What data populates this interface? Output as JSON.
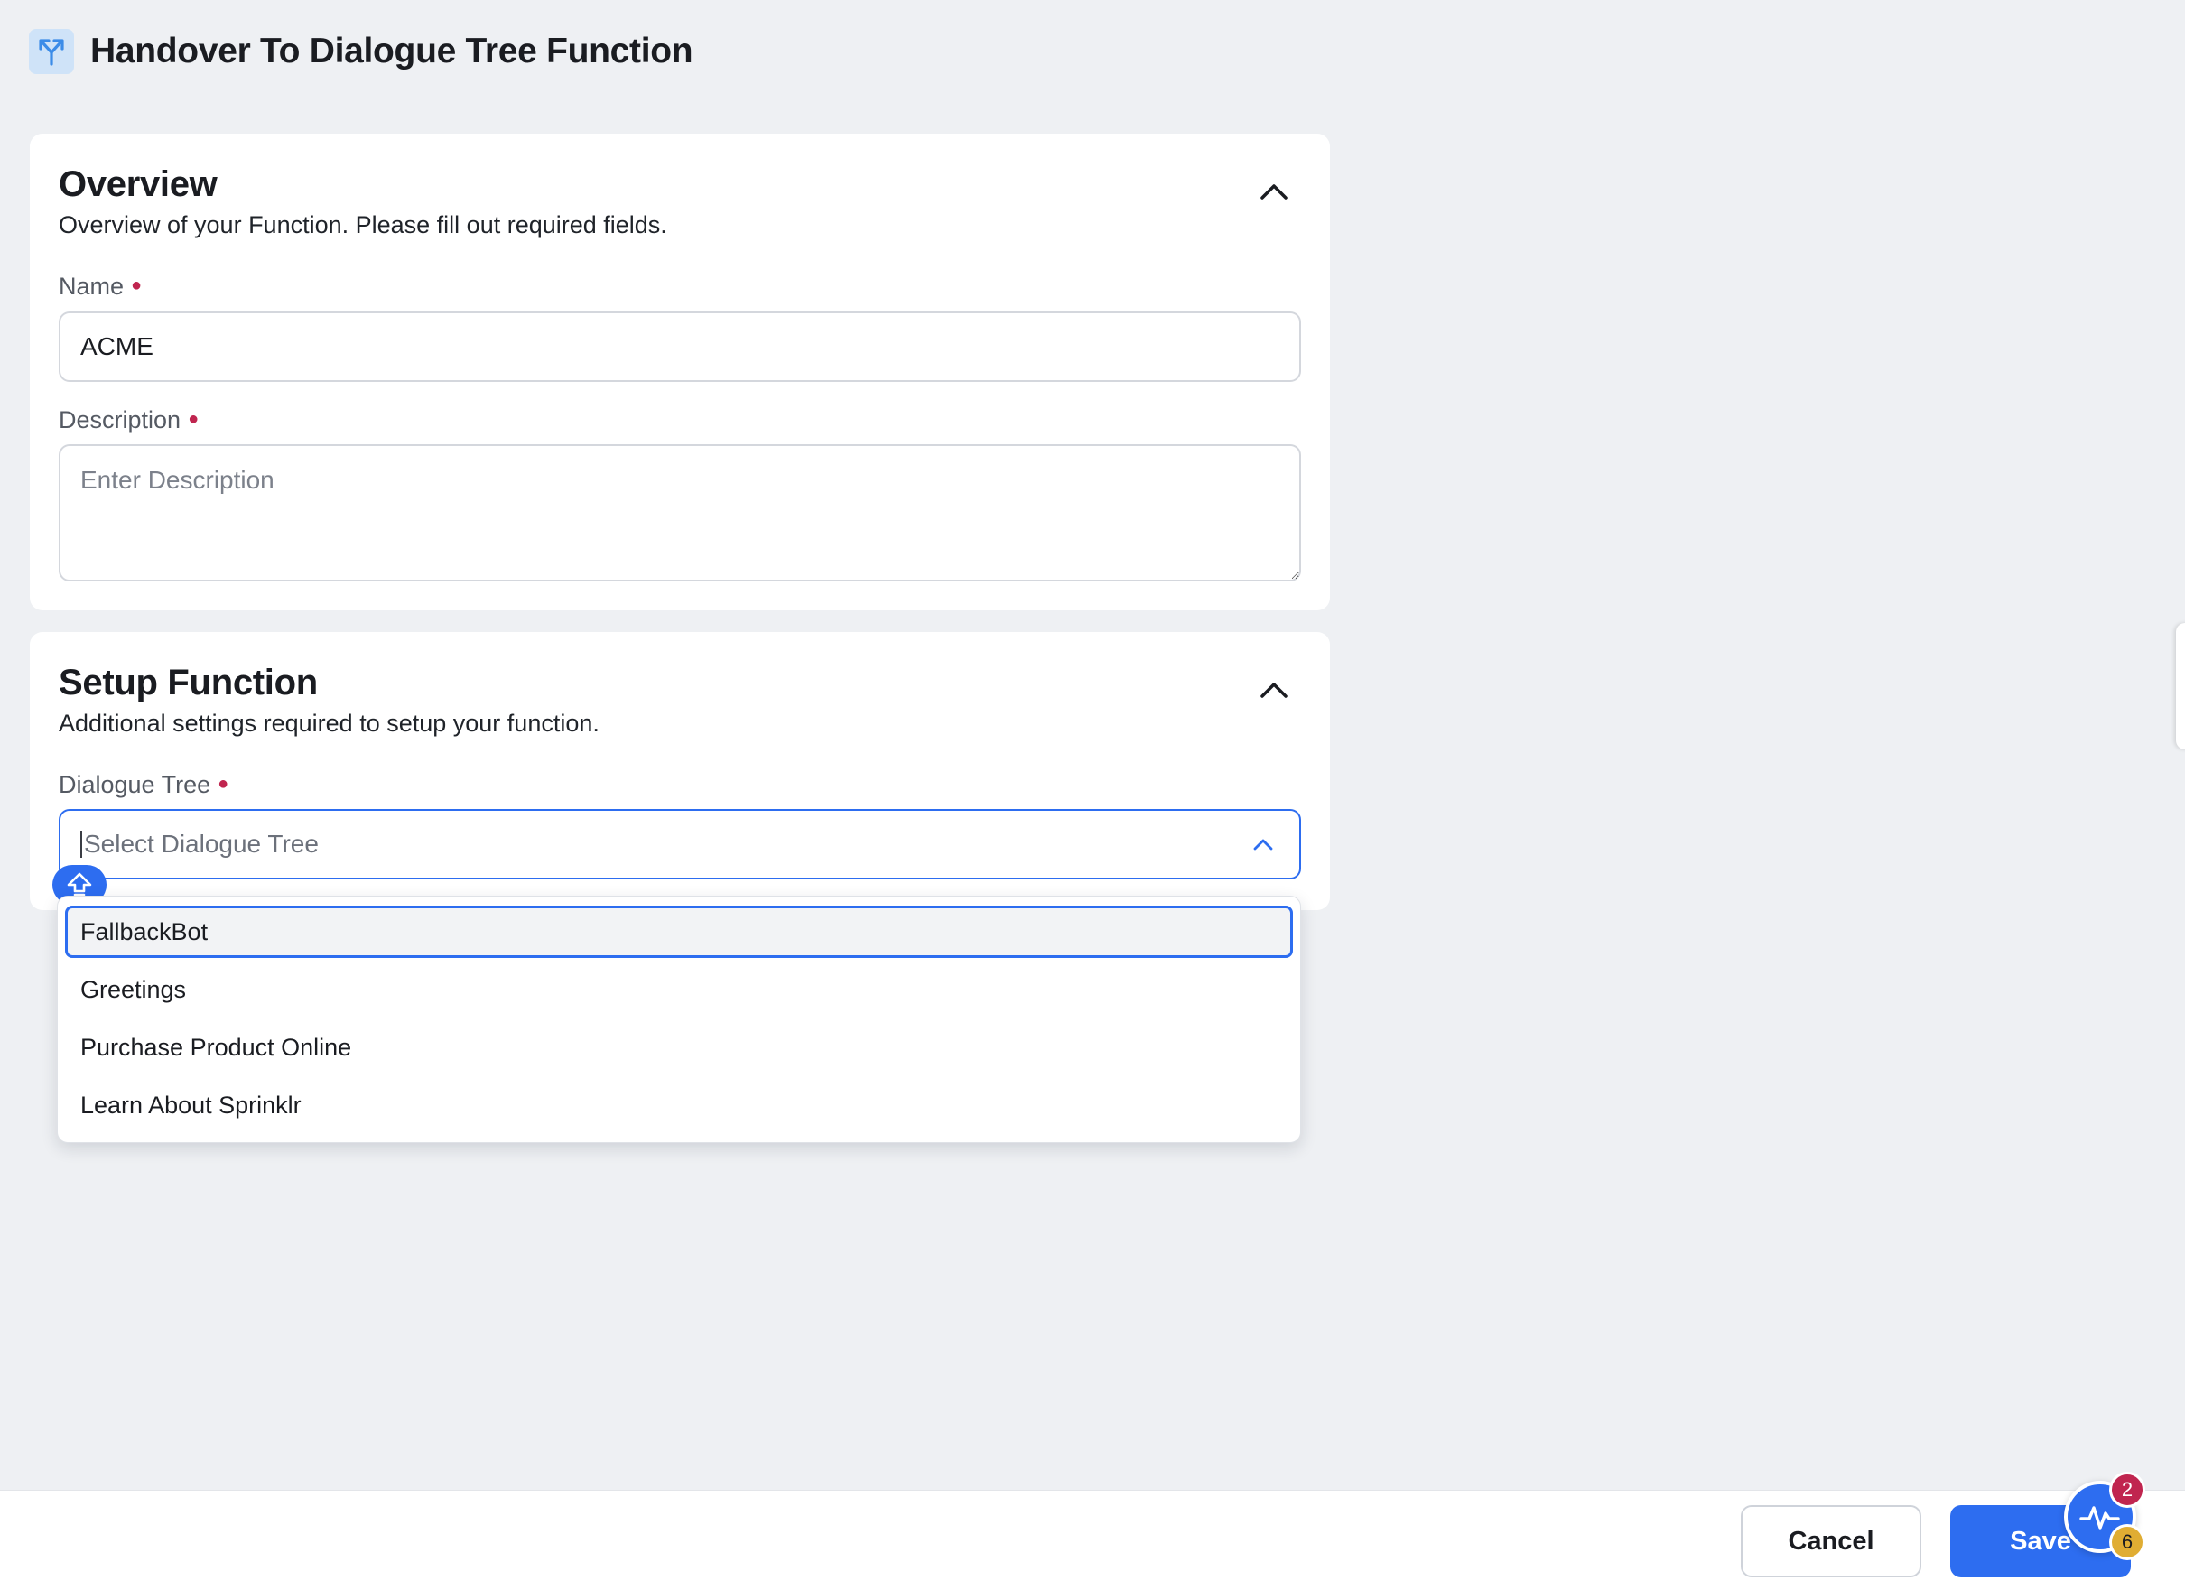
{
  "header": {
    "title": "Handover To Dialogue Tree Function",
    "icon": "split-arrow-icon"
  },
  "overview": {
    "title": "Overview",
    "subtitle": "Overview of your Function. Please fill out required fields.",
    "name_label": "Name",
    "name_value": "ACME",
    "description_label": "Description",
    "description_placeholder": "Enter Description"
  },
  "setup": {
    "title": "Setup Function",
    "subtitle": "Additional settings required to setup your function.",
    "dialogue_tree_label": "Dialogue Tree",
    "dialogue_tree_placeholder": "Select Dialogue Tree",
    "options": [
      "FallbackBot",
      "Greetings",
      "Purchase Product Online",
      "Learn About Sprinklr"
    ],
    "highlighted_option": "FallbackBot"
  },
  "footer": {
    "cancel_label": "Cancel",
    "save_label": "Save"
  },
  "widget": {
    "badge_red": "2",
    "badge_yellow": "6",
    "icon": "activity-pulse-icon"
  },
  "colors": {
    "accent": "#2d6df0",
    "required": "#c0254f",
    "background": "#eef0f3",
    "badge_yellow": "#e0ad33"
  }
}
